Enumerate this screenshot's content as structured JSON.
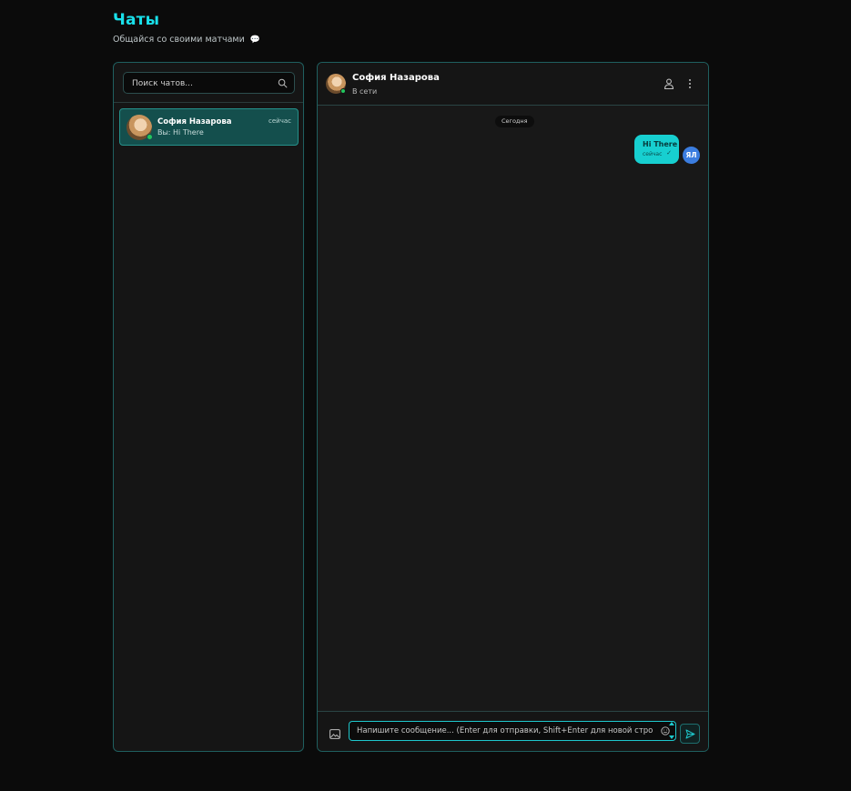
{
  "header": {
    "title": "Чаты",
    "subtitle": "Общайся со своими матчами",
    "subtitle_icon": "speech-bubble-icon"
  },
  "sidebar": {
    "search": {
      "placeholder": "Поиск чатов...",
      "value": ""
    },
    "chats": [
      {
        "name": "София Назарова",
        "time": "сейчас",
        "preview": "Вы: Hi There",
        "online": true,
        "active": true
      }
    ]
  },
  "conversation": {
    "contact_name": "София Назарова",
    "contact_status": "В сети",
    "date_separator": "Сегодня",
    "messages": [
      {
        "text": "Hi There",
        "time": "сейчас",
        "status": "✓",
        "from_me": true,
        "avatar_initials": "ЯЛ"
      }
    ],
    "composer": {
      "placeholder": "Напишите сообщение... (Enter для отправки, Shift+Enter для новой строки)",
      "value": ""
    }
  },
  "colors": {
    "accent": "#19e0ea",
    "panel_border": "#1f5f5f",
    "active_chat_bg": "#144f4d",
    "my_bubble": "#17cfd0",
    "my_avatar": "#3b7de0",
    "online": "#22c55e"
  }
}
